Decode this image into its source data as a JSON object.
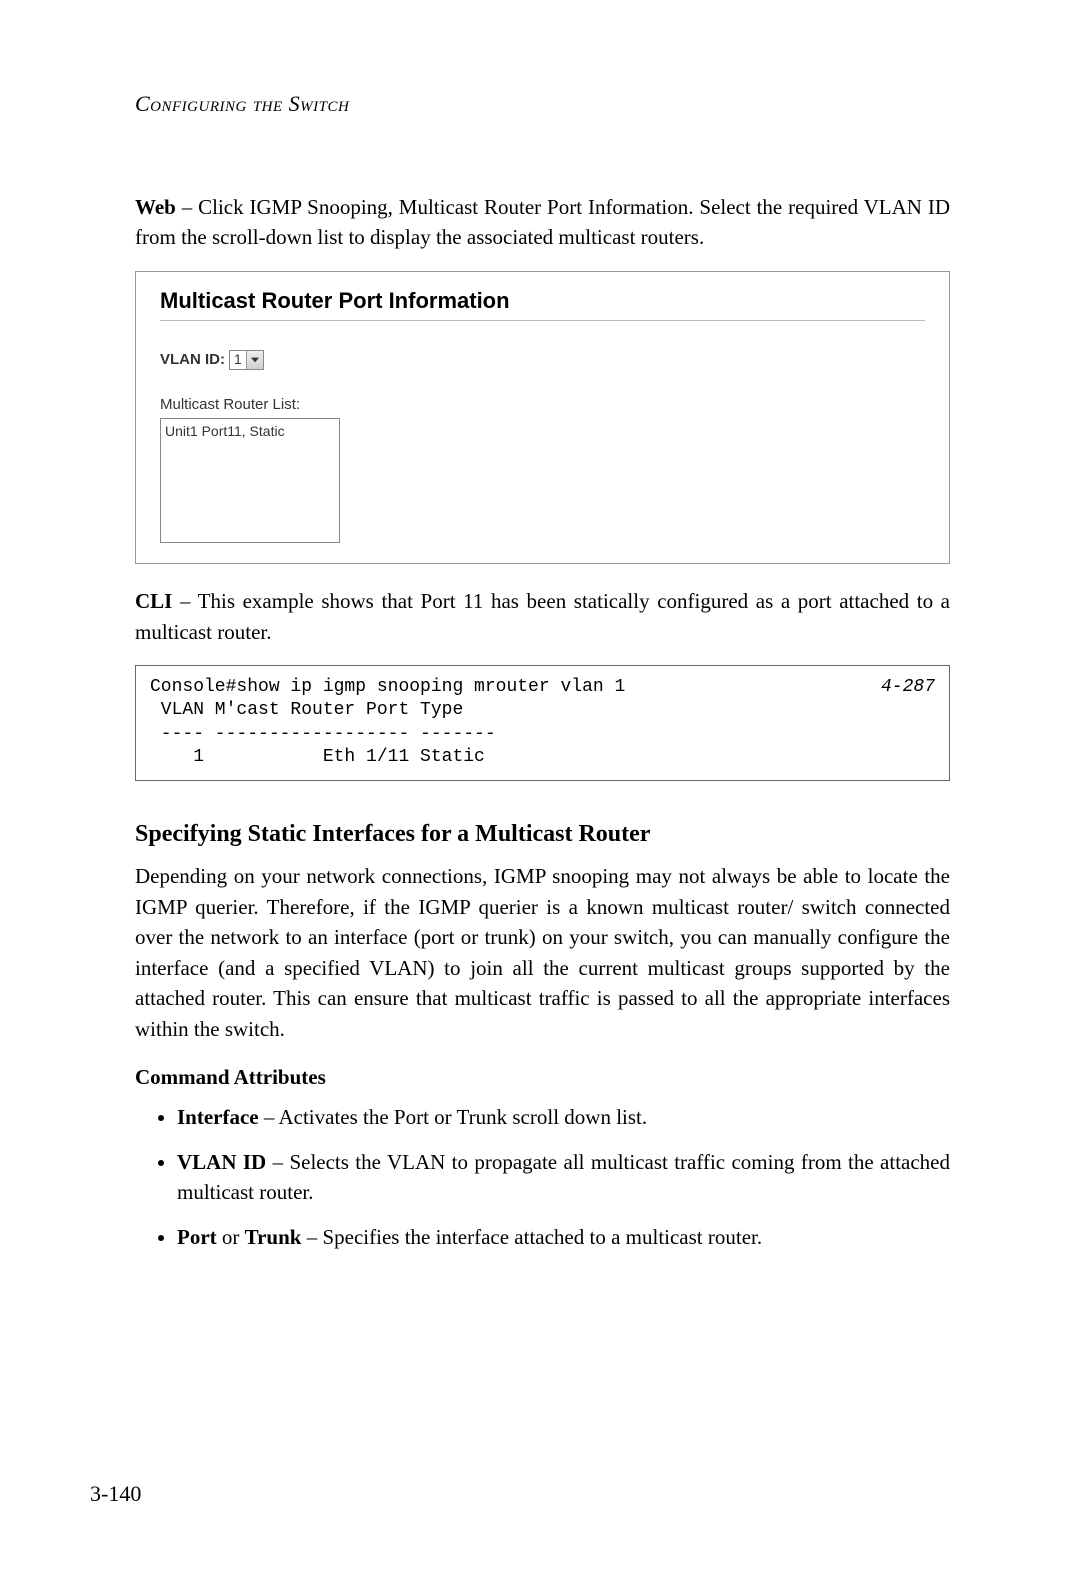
{
  "header": "Configuring the Switch",
  "web_para": {
    "lead": "Web",
    "body": " – Click IGMP Snooping, Multicast Router Port Information. Select the required VLAN ID from the scroll-down list to display the associated multicast routers."
  },
  "panel": {
    "title": "Multicast Router Port Information",
    "vlan_label": "VLAN ID:",
    "vlan_value": "1",
    "list_label": "Multicast Router List:",
    "list_item": "Unit1 Port11, Static"
  },
  "cli_para": {
    "lead": "CLI",
    "body": " – This example shows that Port 11 has been statically configured as a port attached to a multicast router."
  },
  "code": {
    "line1": "Console#show ip igmp snooping mrouter vlan 1",
    "ref": "4-287",
    "line2": " VLAN M'cast Router Port Type",
    "line3": " ---- ------------------ -------",
    "line4": "    1           Eth 1/11 Static"
  },
  "section": {
    "heading": "Specifying Static Interfaces for a Multicast Router",
    "para": "Depending on your network connections, IGMP snooping may not always be able to locate the IGMP querier. Therefore, if the IGMP querier is a known multicast router/ switch connected over the network to an interface (port or trunk) on your switch, you can manually configure the interface (and a specified VLAN) to join all the current multicast groups supported by the attached router. This can ensure that multicast traffic is passed to all the appropriate interfaces within the switch.",
    "attrs_heading": "Command Attributes",
    "attrs": [
      {
        "term": "Interface",
        "desc": " – Activates the Port or Trunk scroll down list."
      },
      {
        "term": "VLAN ID",
        "desc": " – Selects the VLAN to propagate all multicast traffic coming from the attached multicast router."
      },
      {
        "term_a": "Port",
        "or": " or ",
        "term_b": "Trunk",
        "desc": " – Specifies the interface attached to a multicast router."
      }
    ]
  },
  "page_num": "3-140"
}
